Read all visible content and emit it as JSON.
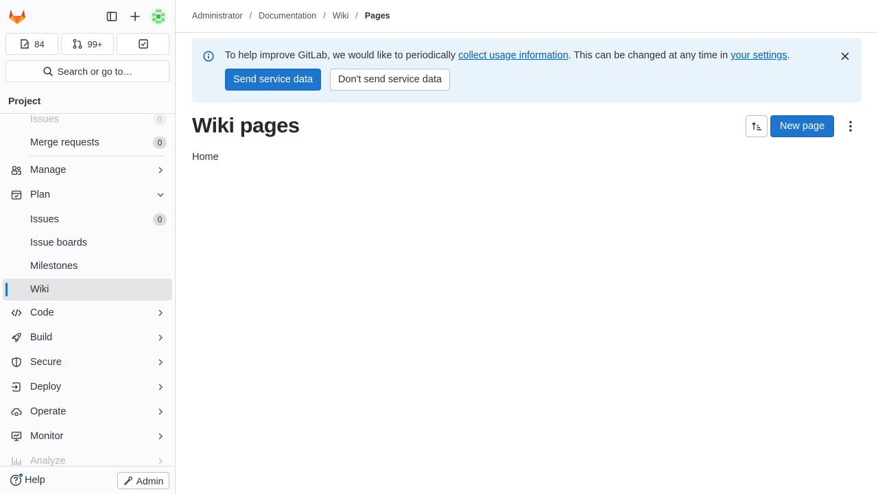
{
  "sidebar": {
    "counts": {
      "issues": "84",
      "merge_requests": "99+"
    },
    "search_label": "Search or go to…",
    "context_title": "Project",
    "items": {
      "issues_faded": {
        "label": "Issues",
        "badge": "0"
      },
      "merge_requests": {
        "label": "Merge requests",
        "badge": "0"
      },
      "manage": {
        "label": "Manage"
      },
      "plan": {
        "label": "Plan"
      },
      "plan_issues": {
        "label": "Issues",
        "badge": "0"
      },
      "issue_boards": {
        "label": "Issue boards"
      },
      "milestones": {
        "label": "Milestones"
      },
      "wiki": {
        "label": "Wiki"
      },
      "code": {
        "label": "Code"
      },
      "build": {
        "label": "Build"
      },
      "secure": {
        "label": "Secure"
      },
      "deploy": {
        "label": "Deploy"
      },
      "operate": {
        "label": "Operate"
      },
      "monitor": {
        "label": "Monitor"
      },
      "analyze": {
        "label": "Analyze"
      }
    },
    "help_label": "Help",
    "admin_label": "Admin"
  },
  "breadcrumb": {
    "items": [
      "Administrator",
      "Documentation",
      "Wiki",
      "Pages"
    ],
    "separator": "/"
  },
  "banner": {
    "text_before": "To help improve GitLab, we would like to periodically ",
    "link1": "collect usage information",
    "text_middle": ". This can be changed at any time in ",
    "link2": "your settings",
    "text_after": ".",
    "send_label": "Send service data",
    "dont_send_label": "Don't send service data"
  },
  "main": {
    "title": "Wiki pages",
    "new_page_label": "New page",
    "pages": [
      "Home"
    ]
  },
  "colors": {
    "primary": "#1f75cb",
    "banner_bg": "#e9f3fc",
    "sidebar_bg": "#fbfafd",
    "active_indicator": "#1f75cb"
  }
}
